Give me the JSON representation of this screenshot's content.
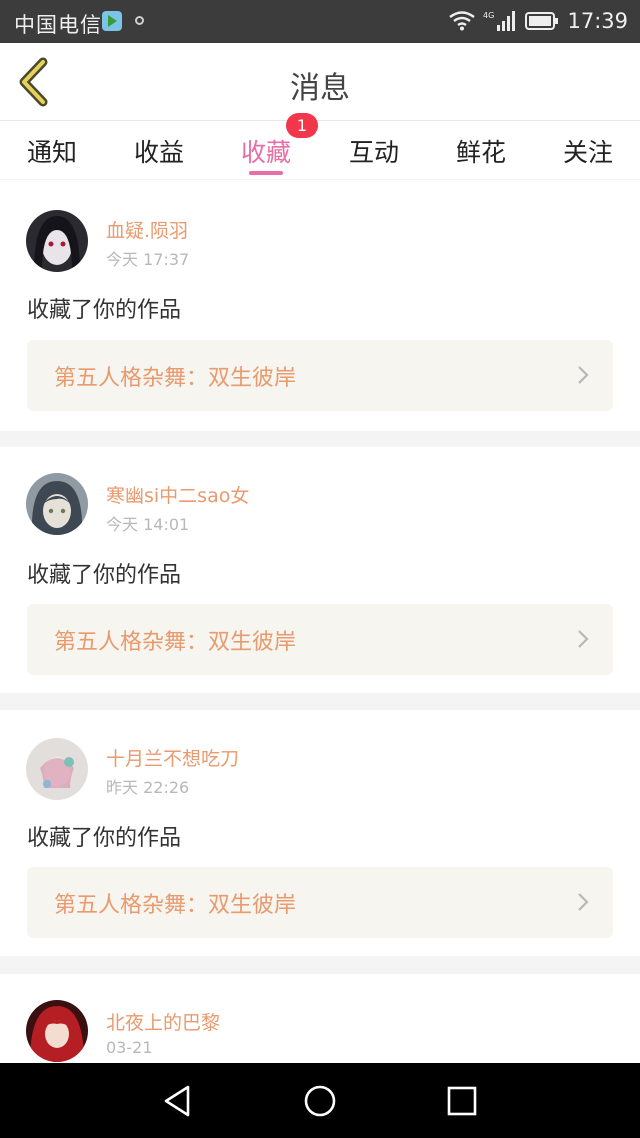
{
  "status_bar": {
    "carrier": "中国电信",
    "network": "4G",
    "time": "17:39"
  },
  "header": {
    "title": "消息",
    "back_icon": "chevron-left-icon"
  },
  "tabs": [
    {
      "label": "通知"
    },
    {
      "label": "收益"
    },
    {
      "label": "收藏",
      "active": true,
      "badge": "1"
    },
    {
      "label": "互动"
    },
    {
      "label": "鲜花"
    },
    {
      "label": "关注"
    }
  ],
  "colors": {
    "accent": "#e76ea7",
    "name_orange": "#e99a6e",
    "badge_red": "#f2374a"
  },
  "messages": [
    {
      "user": "血疑.陨羽",
      "time": "今天 17:37",
      "action": "收藏了你的作品",
      "work": "第五人格杂舞：双生彼岸"
    },
    {
      "user": "寒幽si中二sao女",
      "time": "今天 14:01",
      "action": "收藏了你的作品",
      "work": "第五人格杂舞：双生彼岸"
    },
    {
      "user": "十月兰不想吃刀",
      "time": "昨天 22:26",
      "action": "收藏了你的作品",
      "work": "第五人格杂舞：双生彼岸"
    },
    {
      "user": "北夜上的巴黎",
      "time": "03-21"
    }
  ]
}
